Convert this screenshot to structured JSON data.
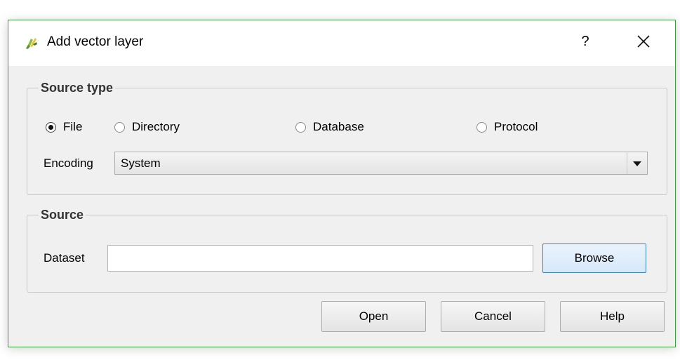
{
  "window": {
    "title": "Add vector layer",
    "help_label": "?",
    "accent_border": "#3f9a3f",
    "icons": {
      "app": "qgis-logo-icon",
      "close": "close-icon"
    }
  },
  "source_type": {
    "title": "Source type",
    "options": [
      {
        "label": "File",
        "selected": true
      },
      {
        "label": "Directory",
        "selected": false
      },
      {
        "label": "Database",
        "selected": false
      },
      {
        "label": "Protocol",
        "selected": false
      }
    ],
    "encoding_label": "Encoding",
    "encoding_value": "System"
  },
  "source": {
    "title": "Source",
    "dataset_label": "Dataset",
    "dataset_value": "",
    "browse_label": "Browse"
  },
  "buttons": {
    "open": "Open",
    "cancel": "Cancel",
    "help": "Help"
  }
}
